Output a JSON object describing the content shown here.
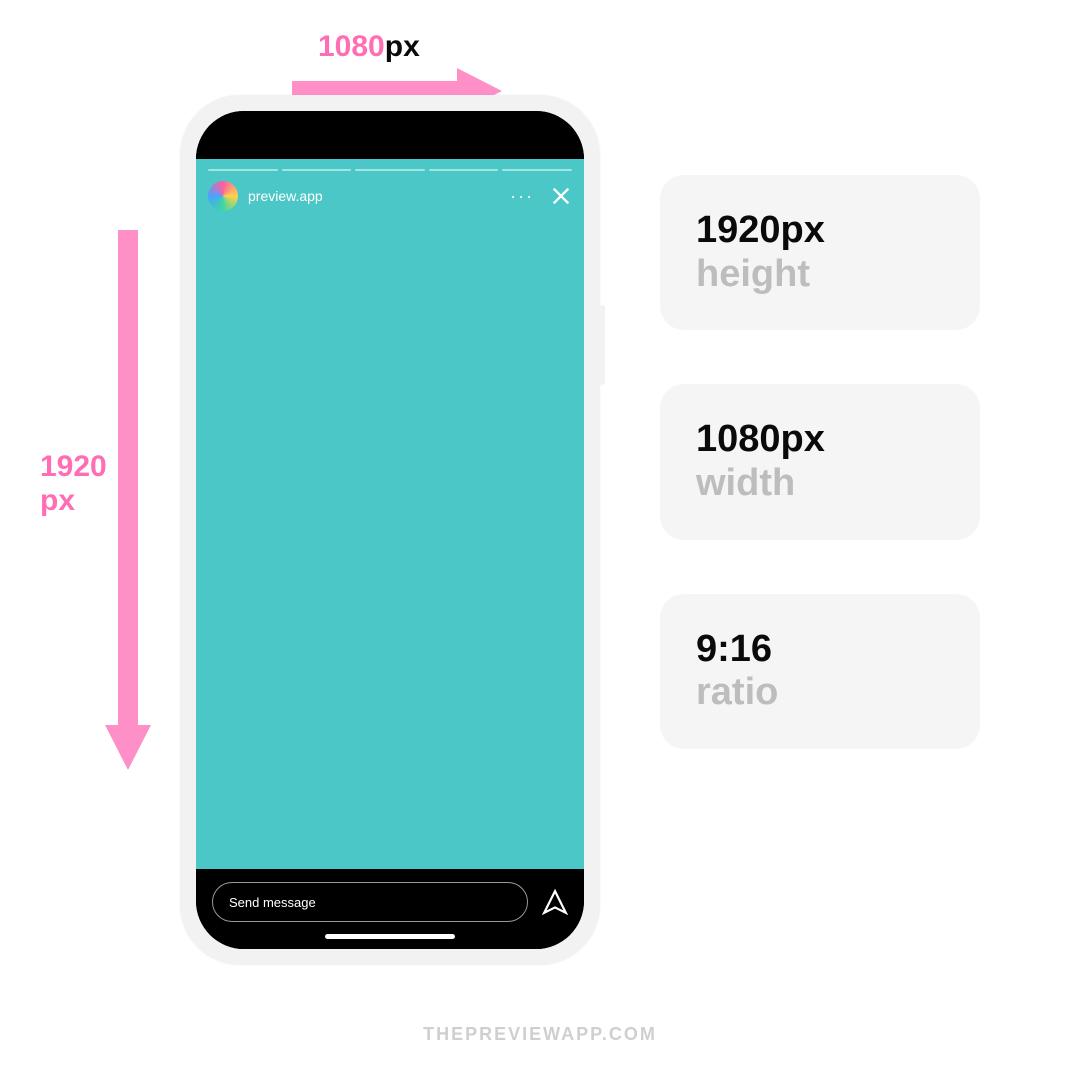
{
  "dimensions": {
    "width_label_num": "1080",
    "width_label_unit": "px",
    "height_label_num": "1920",
    "height_label_unit": "px"
  },
  "story": {
    "username": "preview.app",
    "more": "···",
    "message_placeholder": "Send message"
  },
  "cards": [
    {
      "value": "1920px",
      "label": "height"
    },
    {
      "value": "1080px",
      "label": "width"
    },
    {
      "value": "9:16",
      "label": "ratio"
    }
  ],
  "footer": "THEPREVIEWAPP.COM",
  "colors": {
    "pink": "#ff6eb4",
    "teal": "#4cc7c7"
  }
}
